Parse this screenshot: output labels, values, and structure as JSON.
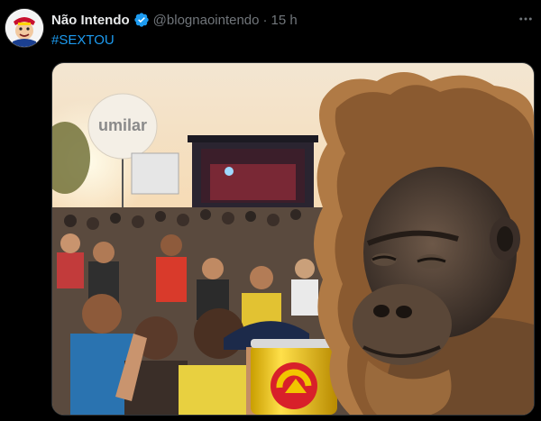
{
  "tweet": {
    "display_name": "Não Intendo",
    "handle": "@blognaointendo",
    "separator": "·",
    "time": "15 h",
    "hashtag": "#SEXTOU",
    "avatar_icon": "newsboy-mascot-icon",
    "verified_icon": "verified-badge-icon",
    "more_icon": "more-options-icon"
  },
  "media": {
    "balloon_text": "umilar",
    "description_icons": [
      "orangutan-meme",
      "crowd-concert",
      "beer-can"
    ]
  },
  "colors": {
    "background": "#000000",
    "text": "#e7e9ea",
    "secondary": "#71767b",
    "accent": "#1d9bf0",
    "can_yellow": "#f2c500",
    "can_red": "#d8202a"
  }
}
